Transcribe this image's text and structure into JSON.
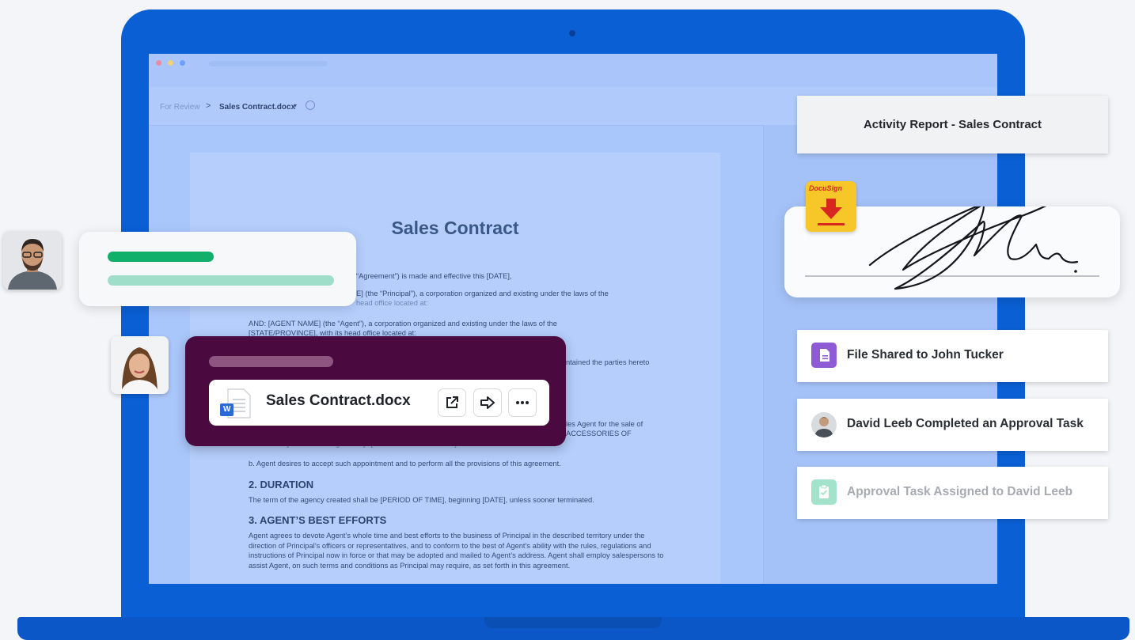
{
  "breadcrumb": {
    "root": "For Review",
    "separator": ">",
    "file": "Sales Contract.docx",
    "caret": "▾"
  },
  "document": {
    "title": "Sales Contract",
    "paragraphs": [
      "“Agreement”) is made and effective this [DATE],",
      "E] (the “Principal”), a corporation organized and existing under the laws of the",
      "head office located at:",
      "AND:   [AGENT NAME] (the “Agent”), a corporation organized and existing under the laws of the",
      "[STATE/PROVINCE], with its head office located at:",
      "ntained the parties hereto",
      "les Agent for the sale of",
      "ACCESSORIES OF",
      "PRINCIPAL] in the following territory: [DESCRIBE TERRITORY].",
      "b.   Agent desires to accept such appointment and to perform all the provisions of this agreement."
    ],
    "sections": [
      {
        "heading": "2.   DURATION",
        "body": "The term of the agency created shall be [PERIOD OF TIME], beginning [DATE], unless sooner terminated."
      },
      {
        "heading": "3.   AGENT’S BEST EFFORTS",
        "body": "Agent agrees to devote Agent’s whole time and best efforts to the business of Principal in the described territory under the direction of Principal’s officers or representatives, and to conform to the best of Agent’s ability with the rules, regulations and instructions of Principal now in force or that may be adopted and mailed to Agent’s address. Agent shall employ salespersons to assist Agent, on such terms and conditions as Principal may require, as set forth in this agreement."
      }
    ]
  },
  "activity": {
    "header": "Activity Report - Sales Contract",
    "items": [
      {
        "text": "File Shared to John Tucker",
        "icon": "document-icon",
        "color": "#8e5ad6"
      },
      {
        "text": "David Leeb Completed an Approval Task",
        "icon": "avatar",
        "color": "#5b6168"
      },
      {
        "text": "Approval Task Assigned to David Leeb",
        "icon": "clipboard-check-icon",
        "color": "#7fd8b8"
      }
    ]
  },
  "signature": {
    "badge_label": "DocuSign"
  },
  "share": {
    "file_name": "Sales Contract.docx",
    "file_type_label": "W"
  },
  "colors": {
    "brand_blue": "#0a5fd4",
    "share_card": "#4a0a40",
    "green_bar": "#10b06a",
    "mint_bar": "#9fdfc9",
    "docusign_yellow": "#f7c628",
    "docusign_red": "#d6281f"
  }
}
